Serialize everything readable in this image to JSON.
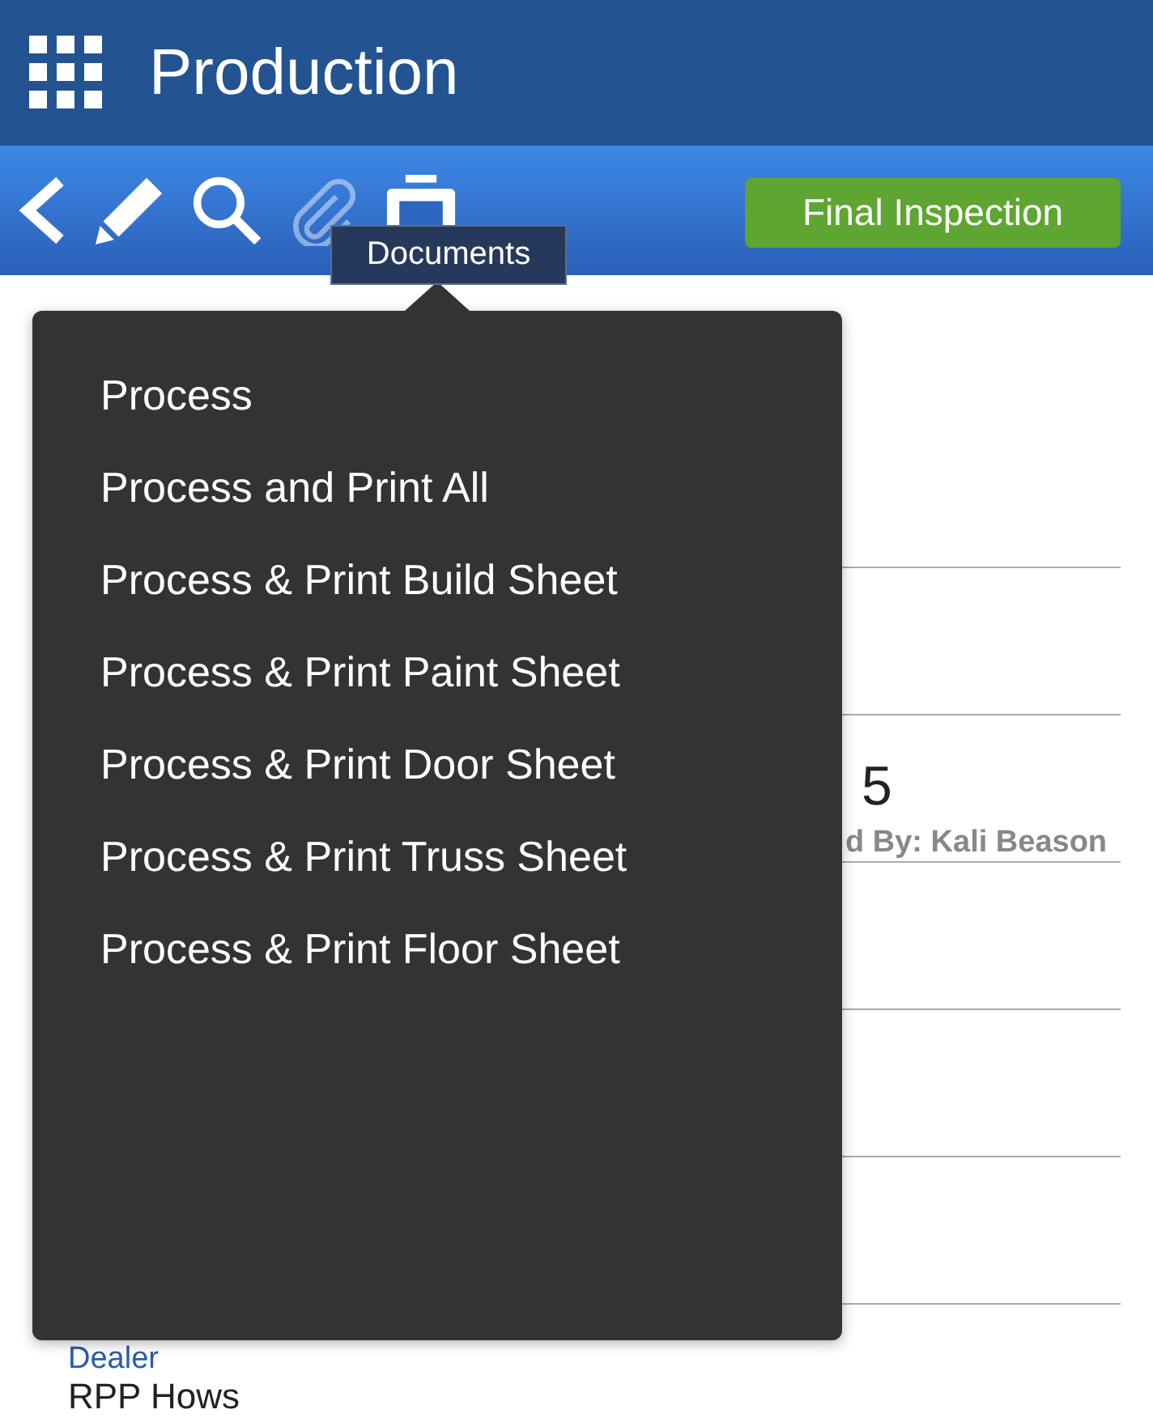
{
  "header": {
    "title": "Production"
  },
  "toolbar": {
    "icons": [
      {
        "kind": "back",
        "disabled": false
      },
      {
        "kind": "edit",
        "disabled": false
      },
      {
        "kind": "search",
        "disabled": false
      },
      {
        "kind": "attach",
        "disabled": true
      },
      {
        "kind": "documents",
        "disabled": false
      }
    ],
    "button": "Final Inspection"
  },
  "tooltip": "Documents",
  "menu": {
    "items": [
      "Process",
      "Process and Print All",
      "Process & Print Build Sheet",
      "Process & Print Paint Sheet",
      "Process & Print Door Sheet",
      "Process & Print Truss Sheet",
      "Process & Print Floor Sheet"
    ]
  },
  "record": {
    "value_fragment": "5",
    "caption_fragment": "d By: Kali Beason",
    "dealer": {
      "label": "Dealer",
      "value": "RPP Hows"
    }
  }
}
